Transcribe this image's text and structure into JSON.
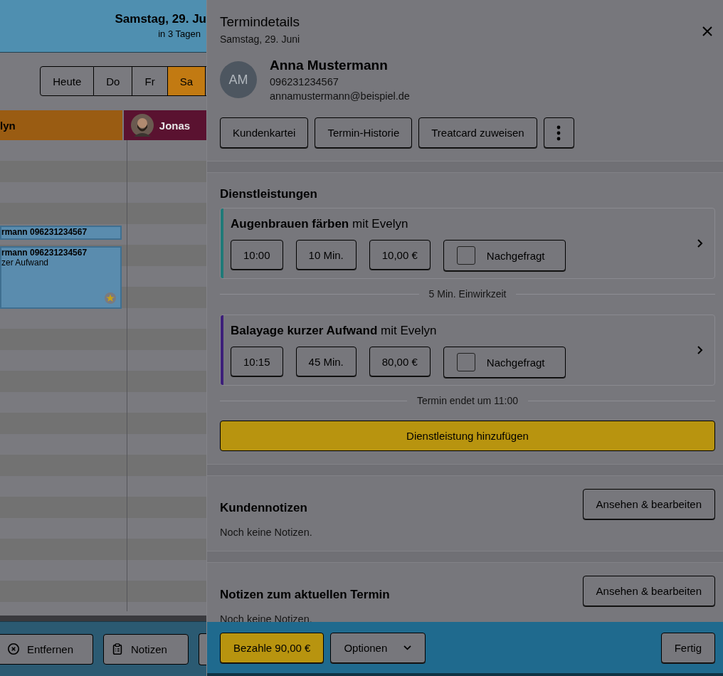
{
  "calendar": {
    "date": "Samstag, 29. Ju",
    "relative": "in 3 Tagen",
    "day_tabs": [
      {
        "label": "Heute",
        "selected": false
      },
      {
        "label": "Do",
        "selected": false
      },
      {
        "label": "Fr",
        "selected": false
      },
      {
        "label": "Sa",
        "selected": true
      }
    ],
    "staff": [
      {
        "name": "lyn",
        "color": "#9a5c12",
        "kind": "text"
      },
      {
        "name": "Jonas",
        "color": "#5a1230",
        "kind": "avatar"
      }
    ],
    "appointments": [
      {
        "title": "rmann 096231234567"
      },
      {
        "title": "rmann 096231234567",
        "subtitle": "zer Aufwand",
        "starred": true
      }
    ],
    "toolbar": [
      {
        "label": "Entfernen",
        "kind": "remove"
      },
      {
        "label": "Notizen",
        "kind": "notes"
      },
      {
        "kind": "cut"
      }
    ]
  },
  "panel": {
    "title": "Termindetails",
    "subtitle": "Samstag, 29. Juni",
    "client": {
      "initials": "AM",
      "name": "Anna Mustermann",
      "phone": "096231234567",
      "email": "annamustermann@beispiel.de"
    },
    "actions": [
      "Kundenkartei",
      "Termin-Historie",
      "Treatcard zuweisen"
    ],
    "services_heading": "Dienstleistungen",
    "services": [
      {
        "title": "**Augenbrauen färben** mit Evelyn",
        "color": "#1f7a78",
        "time": "10:00",
        "duration": "10 Min.",
        "price": "10,00 €",
        "checkbox_label": "Nachgefragt",
        "checked": false,
        "after": "5 Min. Einwirkzeit"
      },
      {
        "title": "**Balayage kurzer Aufwand** mit Evelyn",
        "color": "#3d1f7a",
        "time": "10:15",
        "duration": "45 Min.",
        "price": "80,00 €",
        "checkbox_label": "Nachgefragt",
        "checked": false,
        "after": "Termin endet um 11:00"
      }
    ],
    "add_service": "Dienstleistung hinzufügen",
    "notes": [
      {
        "title": "Kundennotizen",
        "button": "Ansehen & bearbeiten",
        "text": "Noch keine Notizen."
      },
      {
        "title": "Notizen zum aktuellen Termin",
        "button": "Ansehen & bearbeiten",
        "text": "Noch keine Notizen."
      }
    ],
    "footer": {
      "pay": "Bezahle 90,00 €",
      "options": "Optionen",
      "done": "Fertig"
    }
  }
}
